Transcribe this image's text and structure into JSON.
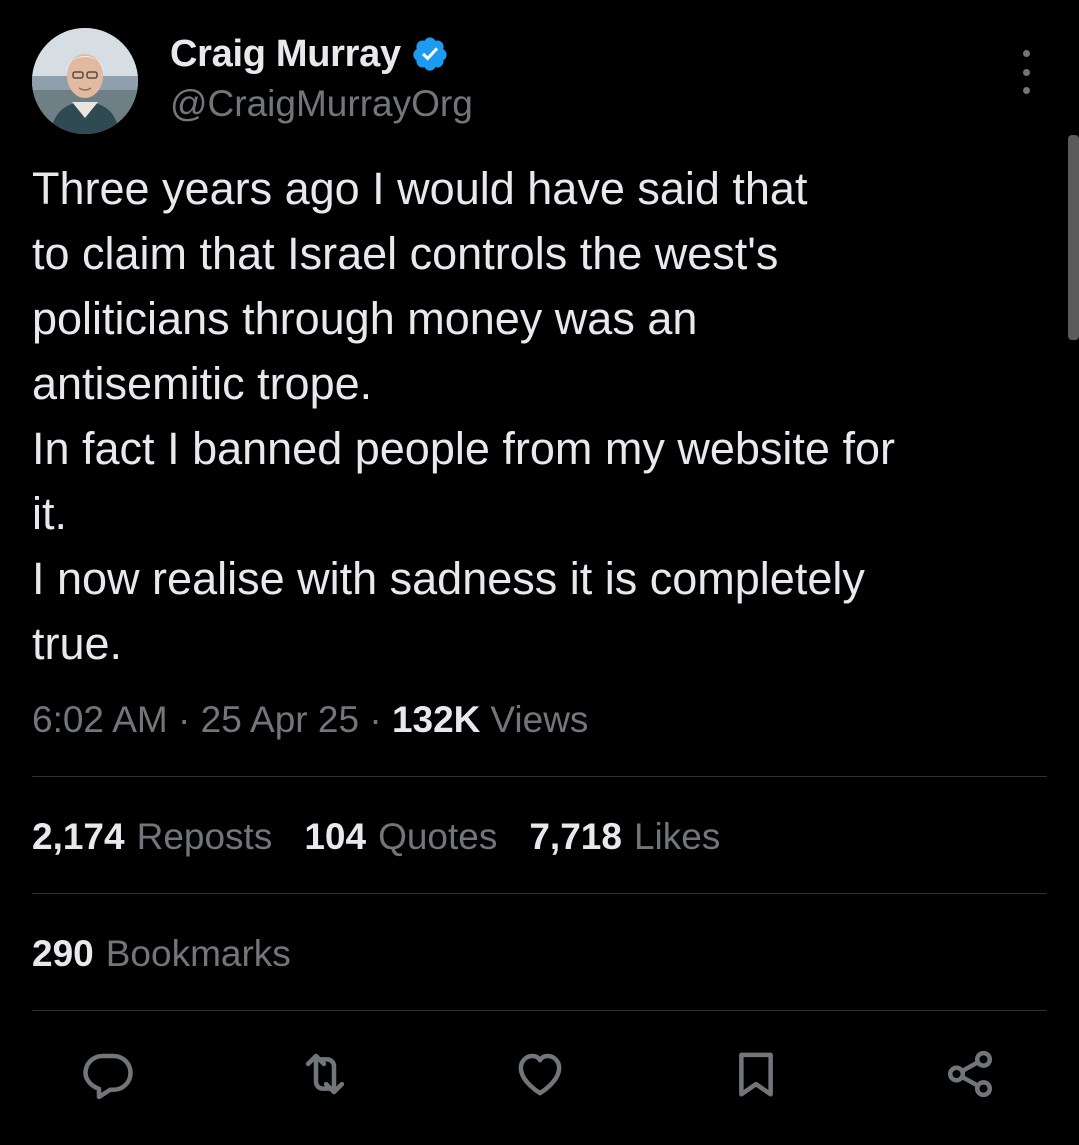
{
  "author": {
    "display_name": "Craig Murray",
    "handle": "@CraigMurrayOrg",
    "verified": true
  },
  "tweet": {
    "lines": [
      "Three years ago I would have said that",
      "to claim that Israel controls the west's",
      "politicians through money was an",
      "antisemitic trope.",
      "In fact I banned people from my website for",
      "it.",
      "I now realise with sadness it is completely",
      "true."
    ],
    "time": "6:02 AM",
    "separator": "·",
    "date": "25 Apr 25",
    "views_count": "132K",
    "views_label": "Views"
  },
  "stats": {
    "reposts_count": "2,174",
    "reposts_label": "Reposts",
    "quotes_count": "104",
    "quotes_label": "Quotes",
    "likes_count": "7,718",
    "likes_label": "Likes",
    "bookmarks_count": "290",
    "bookmarks_label": "Bookmarks"
  },
  "actions": [
    "reply-icon",
    "repost-icon",
    "like-icon",
    "bookmark-icon",
    "share-icon"
  ],
  "colors": {
    "background": "#000000",
    "text_primary": "#e7e9ea",
    "text_secondary": "#71767b",
    "divider": "#2f3336",
    "verified_blue": "#1d9bf0"
  }
}
